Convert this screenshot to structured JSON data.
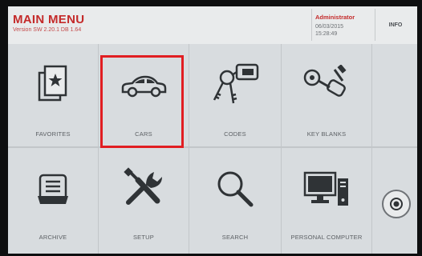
{
  "header": {
    "title": "MAIN MENU",
    "version": "Version SW 2.20.1 DB 1.64",
    "user": "Administrator",
    "date": "06/03/2015",
    "time": "15:28:49",
    "info_label": "INFO"
  },
  "tiles": {
    "favorites": "FAVORITES",
    "cars": "CARS",
    "codes": "CODES",
    "key_blanks": "KEY BLANKS",
    "archive": "ARCHIVE",
    "setup": "SETUP",
    "search": "SEARCH",
    "personal_computer": "PERSONAL COMPUTER"
  },
  "colors": {
    "accent_red": "#c42a2a",
    "highlight_red": "#e11e22",
    "icon": "#2f3336"
  },
  "icons": {
    "favorites": "star-folder-icon",
    "cars": "car-icon",
    "codes": "keys-icon",
    "key_blanks": "key-blank-icon",
    "archive": "archive-tray-icon",
    "setup": "tools-icon",
    "search": "magnifier-icon",
    "personal_computer": "computer-icon",
    "power": "power-icon"
  }
}
